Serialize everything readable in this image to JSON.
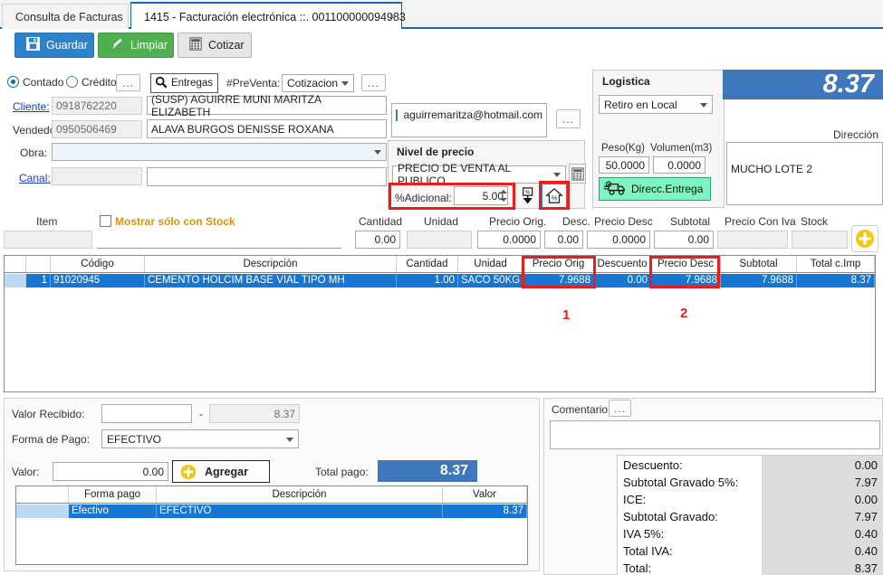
{
  "tabs": [
    {
      "label": "Consulta de Facturas",
      "active": false
    },
    {
      "label": "1415 - Facturación electrónica ::. 001100000094983",
      "active": true,
      "close": "×"
    }
  ],
  "toolbar": {
    "save_label": "Guardar",
    "clear_label": "Limpiar",
    "quote_label": "Cotizar"
  },
  "header": {
    "contado_label": "Contado",
    "credito_label": "Crédito",
    "dots1": "...",
    "entregas_label": "Entregas",
    "preventa_label": "#PreVenta:",
    "preventa_value": "Cotizacion",
    "dots2": "...",
    "cliente_label": "Cliente:",
    "cliente_id": "0918762220",
    "cliente_name": "(SUSP) AGUIRRE MUNI MARITZA ELIZABETH",
    "vendedor_label": "Vendedor:",
    "vendedor_id": "0950506469",
    "vendedor_name": "ALAVA BURGOS DENISSE ROXANA",
    "obra_label": "Obra:",
    "obra_value": "",
    "canal_label": "Canal:",
    "canal_id": "",
    "canal_value": ""
  },
  "email": {
    "value": "aguirremaritza@hotmail.com",
    "checked": true,
    "dots": "..."
  },
  "price_level": {
    "title": "Nivel de precio",
    "level_value": "PRECIO DE VENTA AL PUBLICO",
    "adicional_label": "%Adicional:",
    "adicional_value": "5.00",
    "calculator_icon": "calculator-icon",
    "down_icon": "apply-down-icon",
    "home_icon": "home-price-icon"
  },
  "logistica": {
    "title": "Logistica",
    "mode": "Retiro en Local",
    "peso_label": "Peso(Kg)",
    "peso_value": "50.0000",
    "volumen_label": "Volumen(m3)",
    "volumen_value": "0.0000",
    "direcc_button": "Direcc.Entrega"
  },
  "total_banner": "8.37",
  "direccion": {
    "label": "Dirección",
    "value": "MUCHO LOTE 2"
  },
  "entry": {
    "item_label": "Item",
    "stock_check_label": "Mostrar sólo con Stock",
    "stock_checked": false,
    "item_code": "",
    "item_desc": "",
    "labels": [
      "Cantidad",
      "Unidad",
      "Precio Orig.",
      "Desc.",
      "Precio Desc",
      "Subtotal",
      "Precio Con Iva",
      "Stock"
    ],
    "values": [
      "0.00",
      "",
      "0.0000",
      "0.00",
      "0.0000",
      "0.00",
      "",
      ""
    ],
    "add_icon": "plus-circle-icon"
  },
  "detail_grid": {
    "columns": [
      "",
      "",
      "Código",
      "Descripción",
      "Cantidad",
      "Unidad",
      "Precio Orig",
      "Descuento",
      "Precio Desc",
      "Subtotal",
      "Total c.Imp"
    ],
    "rows": [
      {
        "sel": "",
        "num": "1",
        "codigo": "91020945",
        "descripcion": "CEMENTO HOLCIM BASE VIAL TIPO MH",
        "cantidad": "1.00",
        "unidad": "SACO 50KG",
        "precio_orig": "7.9688",
        "descuento": "0.00",
        "precio_desc": "7.9688",
        "subtotal": "7.9688",
        "total_imp": "8.37"
      }
    ]
  },
  "annotations": [
    {
      "number": "1",
      "target": "precio-orig-column"
    },
    {
      "number": "2",
      "target": "precio-desc-column"
    }
  ],
  "payment": {
    "valor_recibido_label": "Valor Recibido:",
    "valor_recibido_value": "",
    "dash": "-",
    "cambio_value": "8.37",
    "forma_pago_label": "Forma de Pago:",
    "forma_pago_value": "EFECTIVO",
    "valor_label": "Valor:",
    "valor_value": "0.00",
    "agregar_label": "Agregar",
    "total_pago_label": "Total pago:",
    "total_pago_value": "8.37",
    "grid_columns": [
      "",
      "Forma pago",
      "Descripción",
      "Valor"
    ],
    "grid_rows": [
      {
        "forma": "Efectivo",
        "descripcion": "EFECTIVO",
        "valor": "8.37"
      }
    ]
  },
  "comment": {
    "label": "Comentario:",
    "dots": "...",
    "value": ""
  },
  "totals": [
    {
      "label": "Descuento:",
      "value": "0.00"
    },
    {
      "label": "Subtotal Gravado 5%:",
      "value": "7.97"
    },
    {
      "label": "ICE:",
      "value": "0.00"
    },
    {
      "label": "Subtotal Gravado:",
      "value": "7.97"
    },
    {
      "label": "IVA 5%:",
      "value": "0.40"
    },
    {
      "label": "Total IVA:",
      "value": "0.40"
    },
    {
      "label": "Total:",
      "value": "8.37"
    }
  ],
  "colors": {
    "accent_blue": "#1666b0",
    "row_blue": "#1676d2",
    "annotation_red": "#ee1b1b",
    "green_button": "#4fae4f",
    "yellow": "#f5c40f"
  }
}
